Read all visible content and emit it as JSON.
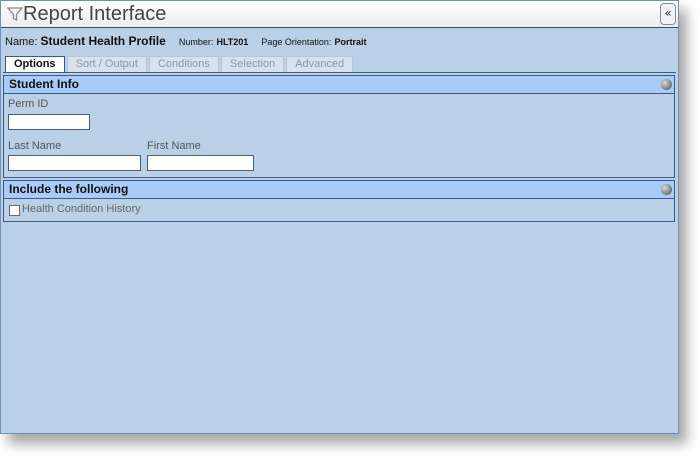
{
  "window": {
    "title": "Report Interface",
    "collapse_button": "«"
  },
  "report": {
    "name_label": "Name:",
    "name_value": "Student Health Profile",
    "number_label": "Number:",
    "number_value": "HLT201",
    "orientation_label": "Page Orientation:",
    "orientation_value": "Portrait"
  },
  "tabs": [
    {
      "label": "Options",
      "active": true
    },
    {
      "label": "Sort / Output",
      "active": false
    },
    {
      "label": "Conditions",
      "active": false
    },
    {
      "label": "Selection",
      "active": false
    },
    {
      "label": "Advanced",
      "active": false
    }
  ],
  "student_info": {
    "header": "Student Info",
    "perm_id": {
      "label": "Perm ID",
      "value": ""
    },
    "last_name": {
      "label": "Last Name",
      "value": ""
    },
    "first_name": {
      "label": "First Name",
      "value": ""
    }
  },
  "include": {
    "header": "Include the following",
    "health_condition_history": {
      "label": "Health Condition History",
      "checked": false
    }
  },
  "colors": {
    "panel_bg": "#bad0e6",
    "section_header_bg": "#a9cbf7",
    "border": "#3b5a85"
  },
  "icons": {
    "title": "filter-icon",
    "collapse": "collapse-icon",
    "section_toggle": "circle-toggle-icon"
  }
}
